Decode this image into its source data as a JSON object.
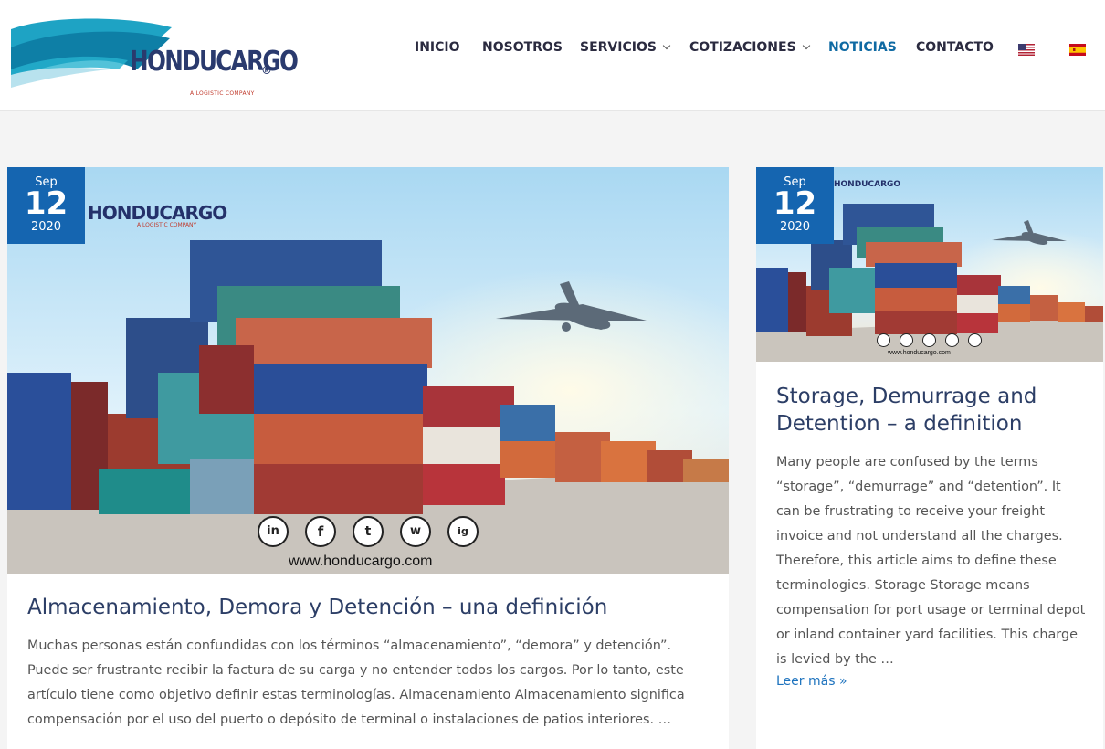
{
  "header": {
    "logo_text": "HONDUCARGO",
    "logo_reg": "®",
    "logo_tagline": "A LOGISTIC COMPANY",
    "nav": [
      {
        "label": "INICIO",
        "has_caret": false,
        "active": false
      },
      {
        "label": "NOSOTROS",
        "has_caret": false,
        "active": false
      },
      {
        "label": "SERVICIOS",
        "has_caret": true,
        "active": false
      },
      {
        "label": "COTIZACIONES",
        "has_caret": true,
        "active": false
      },
      {
        "label": "NOTICIAS",
        "has_caret": false,
        "active": true
      },
      {
        "label": "CONTACTO",
        "has_caret": false,
        "active": false
      }
    ],
    "flags": [
      "us-flag-icon",
      "spain-flag-icon"
    ]
  },
  "posts": [
    {
      "date": {
        "month": "Sep",
        "day": "12",
        "year": "2020"
      },
      "title": "Almacenamiento, Demora y Detención – una definición",
      "excerpt": "Muchas personas están confundidas con los términos “almacenamiento”, “demora” y detención”. Puede ser frustrante recibir la factura de su carga y no entender todos los cargos. Por lo tanto, este artículo tiene como objetivo definir estas terminologías. Almacenamiento Almacenamiento significa compensación por el uso del puerto o depósito de terminal o instalaciones de patios interiores. …",
      "image_website": "www.honducargo.com",
      "image_logo": "HONDUCARGO",
      "image_tagline": "A LOGISTIC COMPANY"
    },
    {
      "date": {
        "month": "Sep",
        "day": "12",
        "year": "2020"
      },
      "title": "Storage, Demurrage and Detention – a definition",
      "excerpt": "Many people are confused by the terms “storage”, “demurrage” and “detention”. It can be frustrating to receive your freight invoice and not understand all the charges. Therefore, this article aims to define these terminologies. Storage Storage means compensation for port usage or terminal depot or inland container yard facilities. This charge is levied by the …",
      "read_more": "Leer más »",
      "image_website": "www.honducargo.com",
      "image_logo": "HONDUCARGO"
    }
  ],
  "social_icons": [
    "linkedin-icon",
    "facebook-icon",
    "twitter-icon",
    "whatsapp-icon",
    "instagram-icon"
  ],
  "social_labels": [
    "in",
    "f",
    "t",
    "w",
    "ig"
  ],
  "colors": {
    "accent": "#1565b0",
    "nav_active": "#0f6aa3",
    "title": "#2c3e66",
    "link": "#1e73be"
  }
}
